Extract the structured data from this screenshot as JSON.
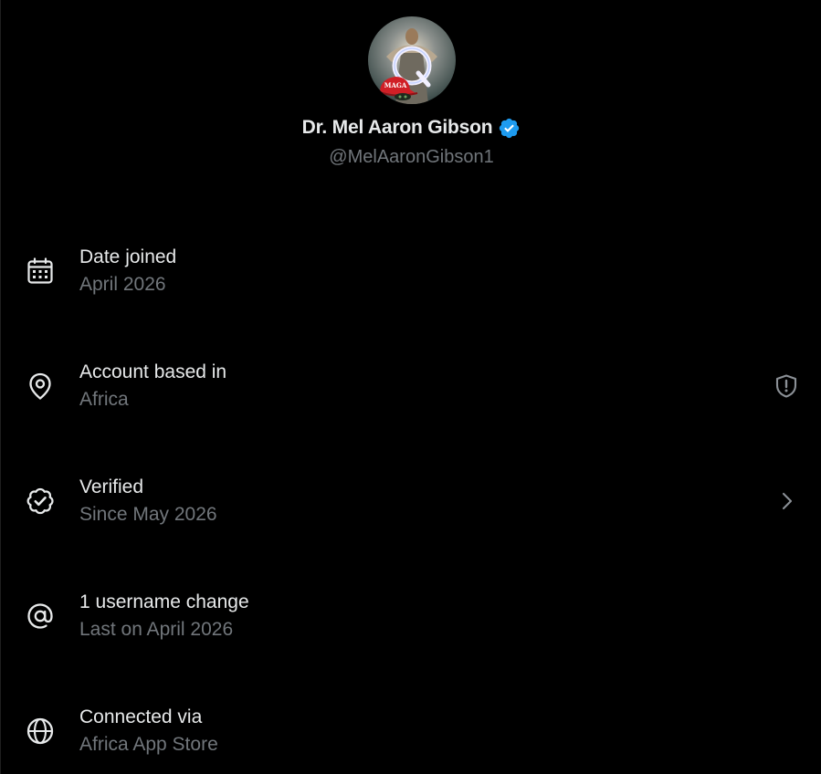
{
  "profile": {
    "display_name": "Dr. Mel Aaron Gibson",
    "handle": "@MelAaronGibson1",
    "avatar_icon": "avatar-image",
    "avatar_hat_text": "MAGA",
    "avatar_letter": "Q",
    "verified_icon": "verified-badge-icon"
  },
  "rows": [
    {
      "icon": "calendar-icon",
      "title": "Date joined",
      "subtitle": "April 2026"
    },
    {
      "icon": "location-pin-icon",
      "title": "Account based in",
      "subtitle": "Africa",
      "action_icon": "shield-alert-icon"
    },
    {
      "icon": "verified-check-icon",
      "title": "Verified",
      "subtitle": "Since May 2026",
      "action_icon": "chevron-right-icon"
    },
    {
      "icon": "at-sign-icon",
      "title": "1 username change",
      "subtitle": "Last on April 2026"
    },
    {
      "icon": "globe-icon",
      "title": "Connected via",
      "subtitle": "Africa App Store"
    }
  ],
  "colors": {
    "background": "#000000",
    "primary_text": "#e7e9ea",
    "secondary_text": "#71767b",
    "verified_blue": "#1d9bf0"
  }
}
